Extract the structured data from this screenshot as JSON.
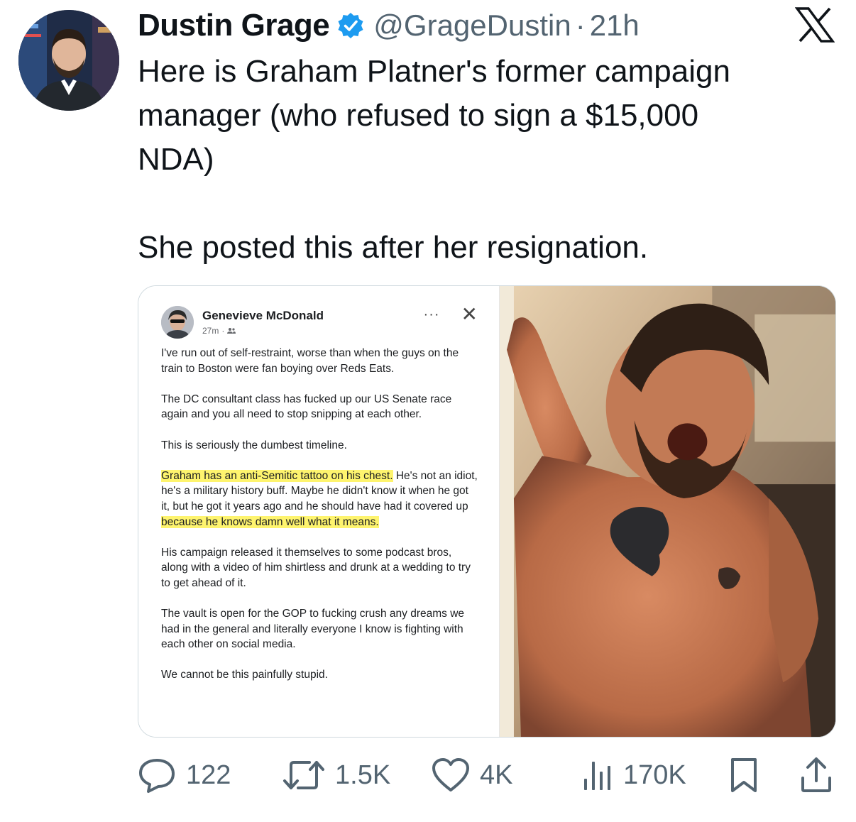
{
  "author": {
    "name": "Dustin Grage",
    "handle": "@GrageDustin",
    "separator": "·",
    "time": "21h",
    "verified_icon": "verified-badge-icon",
    "verified_color": "#1d9bf0"
  },
  "platform_logo": "x-logo-icon",
  "tweet": {
    "paragraph1": "Here is Graham Platner's former campaign\nmanager (who refused to sign a $15,000\nNDA)",
    "paragraph2": "She posted this after her resignation."
  },
  "embedded_post": {
    "name": "Genevieve McDonald",
    "time": "27m",
    "audience_icon": "friends-icon",
    "more_icon": "···",
    "close_icon": "✕",
    "p1": "I've run out of self-restraint, worse than when the guys on the train to Boston were fan boying over Reds Eats.",
    "p2": "The DC consultant class has fucked up our US Senate race again and you all need to stop snipping at each other.",
    "p3": "This is seriously the dumbest timeline.",
    "p4_highlight1": "Graham has an anti-Semitic tattoo on his chest.",
    "p4_plain": " He's not an idiot, he's a military history buff. Maybe he didn't know it when he got it, but he got it years ago and he should have had it covered up ",
    "p4_highlight2": "because he knows damn well what it means.",
    "p5": "His campaign released it themselves to some podcast bros, along with a video of him shirtless and drunk at a wedding to try to get ahead of it.",
    "p6": "The vault is open for the GOP to fucking crush any dreams we had in the general and literally everyone I know is fighting with each other on social media.",
    "p7": "We cannot be this painfully stupid.",
    "highlight_color": "#fef46e"
  },
  "metrics": {
    "replies": "122",
    "reposts": "1.5K",
    "likes": "4K",
    "views": "170K"
  },
  "colors": {
    "text": "#0f1419",
    "secondary": "#536471",
    "border": "#cfd9de"
  }
}
